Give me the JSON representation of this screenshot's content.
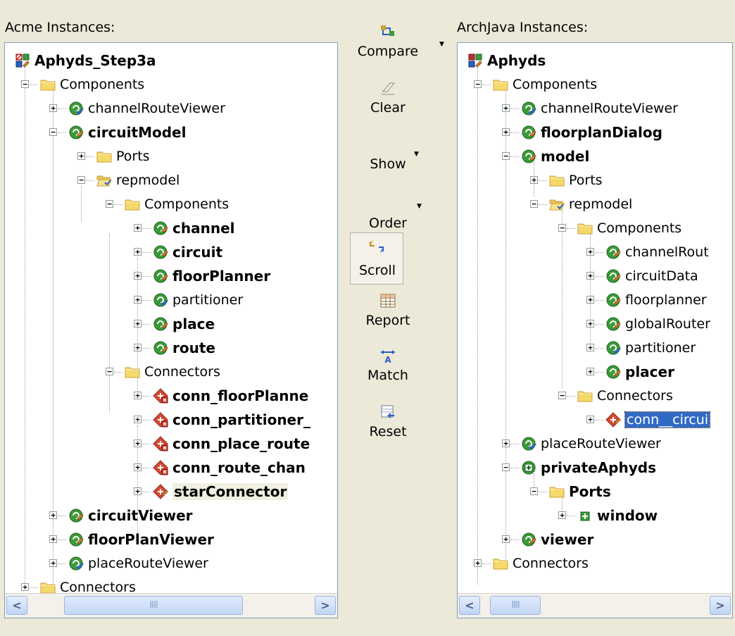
{
  "left": {
    "title": "Acme Instances:",
    "root": "Aphyds_Step3a",
    "nodes": {
      "n1": "Components",
      "n2": "channelRouteViewer",
      "n3": "circuitModel",
      "n4": "Ports",
      "n5": "repmodel",
      "n6": "Components",
      "n7": "channel",
      "n8": "circuit",
      "n9": "floorPlanner",
      "n10": "partitioner",
      "n11": "place",
      "n12": "route",
      "n13": "Connectors",
      "n14": "conn_floorPlanne",
      "n15": "conn_partitioner_",
      "n16": "conn_place_route",
      "n17": "conn_route_chan",
      "n18": "starConnector",
      "n19": "circuitViewer",
      "n20": "floorPlanViewer",
      "n21": "placeRouteViewer",
      "n22": "Connectors"
    },
    "scroll_thumb": "IIII"
  },
  "toolbar": {
    "compare": "Compare",
    "clear": "Clear",
    "show": "Show",
    "order": "Order",
    "scroll": "Scroll",
    "report": "Report",
    "match": "Match",
    "reset": "Reset"
  },
  "right": {
    "title": "ArchJava Instances:",
    "root": "Aphyds",
    "nodes": {
      "n1": "Components",
      "n2": "channelRouteViewer",
      "n3": "floorplanDialog",
      "n4": "model",
      "n5": "Ports",
      "n6": "repmodel",
      "n7": "Components",
      "n8": "channelRout",
      "n9": "circuitData",
      "n10": "floorplanner",
      "n11": "globalRouter",
      "n12": "partitioner",
      "n13": "placer",
      "n14": "Connectors",
      "n15": "conn__circui",
      "n16": "placeRouteViewer",
      "n17": "privateAphyds",
      "n18": "Ports",
      "n19": "window",
      "n20": "viewer",
      "n21": "Connectors"
    },
    "scroll_thumb": "IIII"
  },
  "colors": {
    "background": "#ece9d8",
    "selection": "#316ac5",
    "tree_border": "#7f9db9",
    "folder": "#f5d96b",
    "component_green": "#3c9a3a",
    "connector_red": "#d24a34"
  }
}
